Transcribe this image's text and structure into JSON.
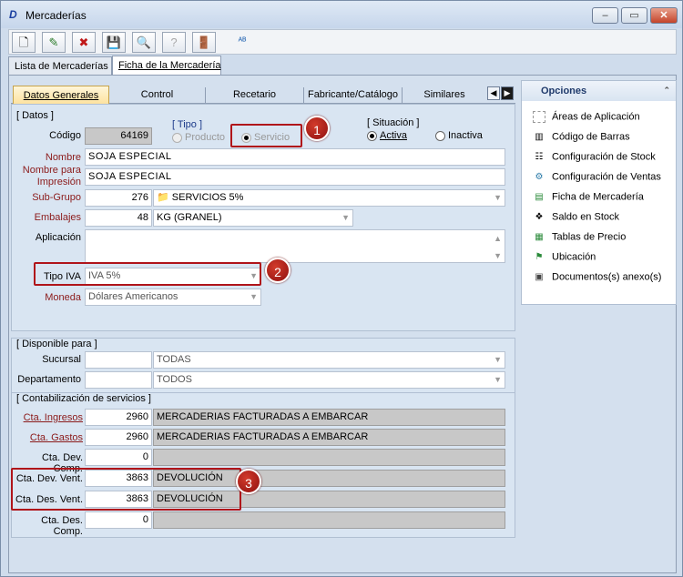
{
  "window": {
    "title": "Mercaderías",
    "app_icon_glyph": "D"
  },
  "toolbar": {
    "buttons": [
      {
        "name": "new-document-icon",
        "glyph": "🗋"
      },
      {
        "name": "edit-document-icon",
        "glyph": "✎"
      },
      {
        "name": "delete-document-icon",
        "glyph": "✖"
      },
      {
        "name": "save-icon",
        "glyph": "💾"
      },
      {
        "name": "search-icon",
        "glyph": "🔍"
      },
      {
        "name": "help-icon",
        "glyph": "?"
      },
      {
        "name": "exit-door-icon",
        "glyph": "🚪"
      },
      {
        "name": "spellcheck-icon",
        "glyph": "ᴬᴮ"
      }
    ]
  },
  "outer_tabs": [
    "Lista de Mercaderías",
    "Ficha de la Mercadería"
  ],
  "inner_tabs": [
    "Datos Generales",
    "Control",
    "Recetario",
    "Fabricante/Catálogo",
    "Similares"
  ],
  "datos": {
    "group_caption": "[ Datos ]",
    "codigo_label": "Código",
    "codigo_value": "64169",
    "tipo_caption": "[ Tipo ]",
    "tipo_options": [
      "Producto",
      "Servicio"
    ],
    "situacion_caption": "[ Situación ]",
    "situacion_options": [
      "Activa",
      "Inactiva"
    ],
    "nombre_label": "Nombre",
    "nombre_value": "SOJA ESPECIAL",
    "nombre_impresion_label_1": "Nombre para",
    "nombre_impresion_label_2": "Impresión",
    "nombre_impresion_value": "SOJA ESPECIAL",
    "subgrupo_label": "Sub-Grupo",
    "subgrupo_code": "276",
    "subgrupo_value": "SERVICIOS 5%",
    "embalajes_label": "Embalajes",
    "embalajes_code": "48",
    "embalajes_value": "KG (GRANEL)",
    "aplicacion_label": "Aplicación",
    "tipo_iva_label": "Tipo IVA",
    "tipo_iva_value": "IVA 5%",
    "moneda_label": "Moneda",
    "moneda_value": "Dólares Americanos"
  },
  "disponible": {
    "caption": "[ Disponible para ]",
    "sucursal_label": "Sucursal",
    "sucursal_value": "TODAS",
    "departamento_label": "Departamento",
    "departamento_value": "TODOS"
  },
  "contabilizacion": {
    "caption": "[ Contabilización de servicios ]",
    "rows": [
      {
        "label": "Cta. Ingresos",
        "code": "2960",
        "desc": "MERCADERIAS FACTURADAS A EMBARCAR"
      },
      {
        "label": "Cta. Gastos",
        "code": "2960",
        "desc": "MERCADERIAS FACTURADAS A EMBARCAR"
      },
      {
        "label": "Cta. Dev. Comp.",
        "code": "0",
        "desc": ""
      },
      {
        "label": "Cta. Dev. Vent.",
        "code": "3863",
        "desc": "DEVOLUCIÓN"
      },
      {
        "label": "Cta. Des. Vent.",
        "code": "3863",
        "desc": "DEVOLUCIÓN"
      },
      {
        "label": "Cta. Des. Comp.",
        "code": "0",
        "desc": ""
      }
    ]
  },
  "opciones": {
    "title": "Opciones",
    "items": [
      "Áreas de Aplicación",
      "Código de Barras",
      "Configuración de Stock",
      "Configuración de Ventas",
      "Ficha de Mercadería",
      "Saldo en Stock",
      "Tablas de Precio",
      "Ubicación",
      "Documentos(s) anexo(s)"
    ]
  },
  "markers": [
    "1",
    "2",
    "3"
  ]
}
